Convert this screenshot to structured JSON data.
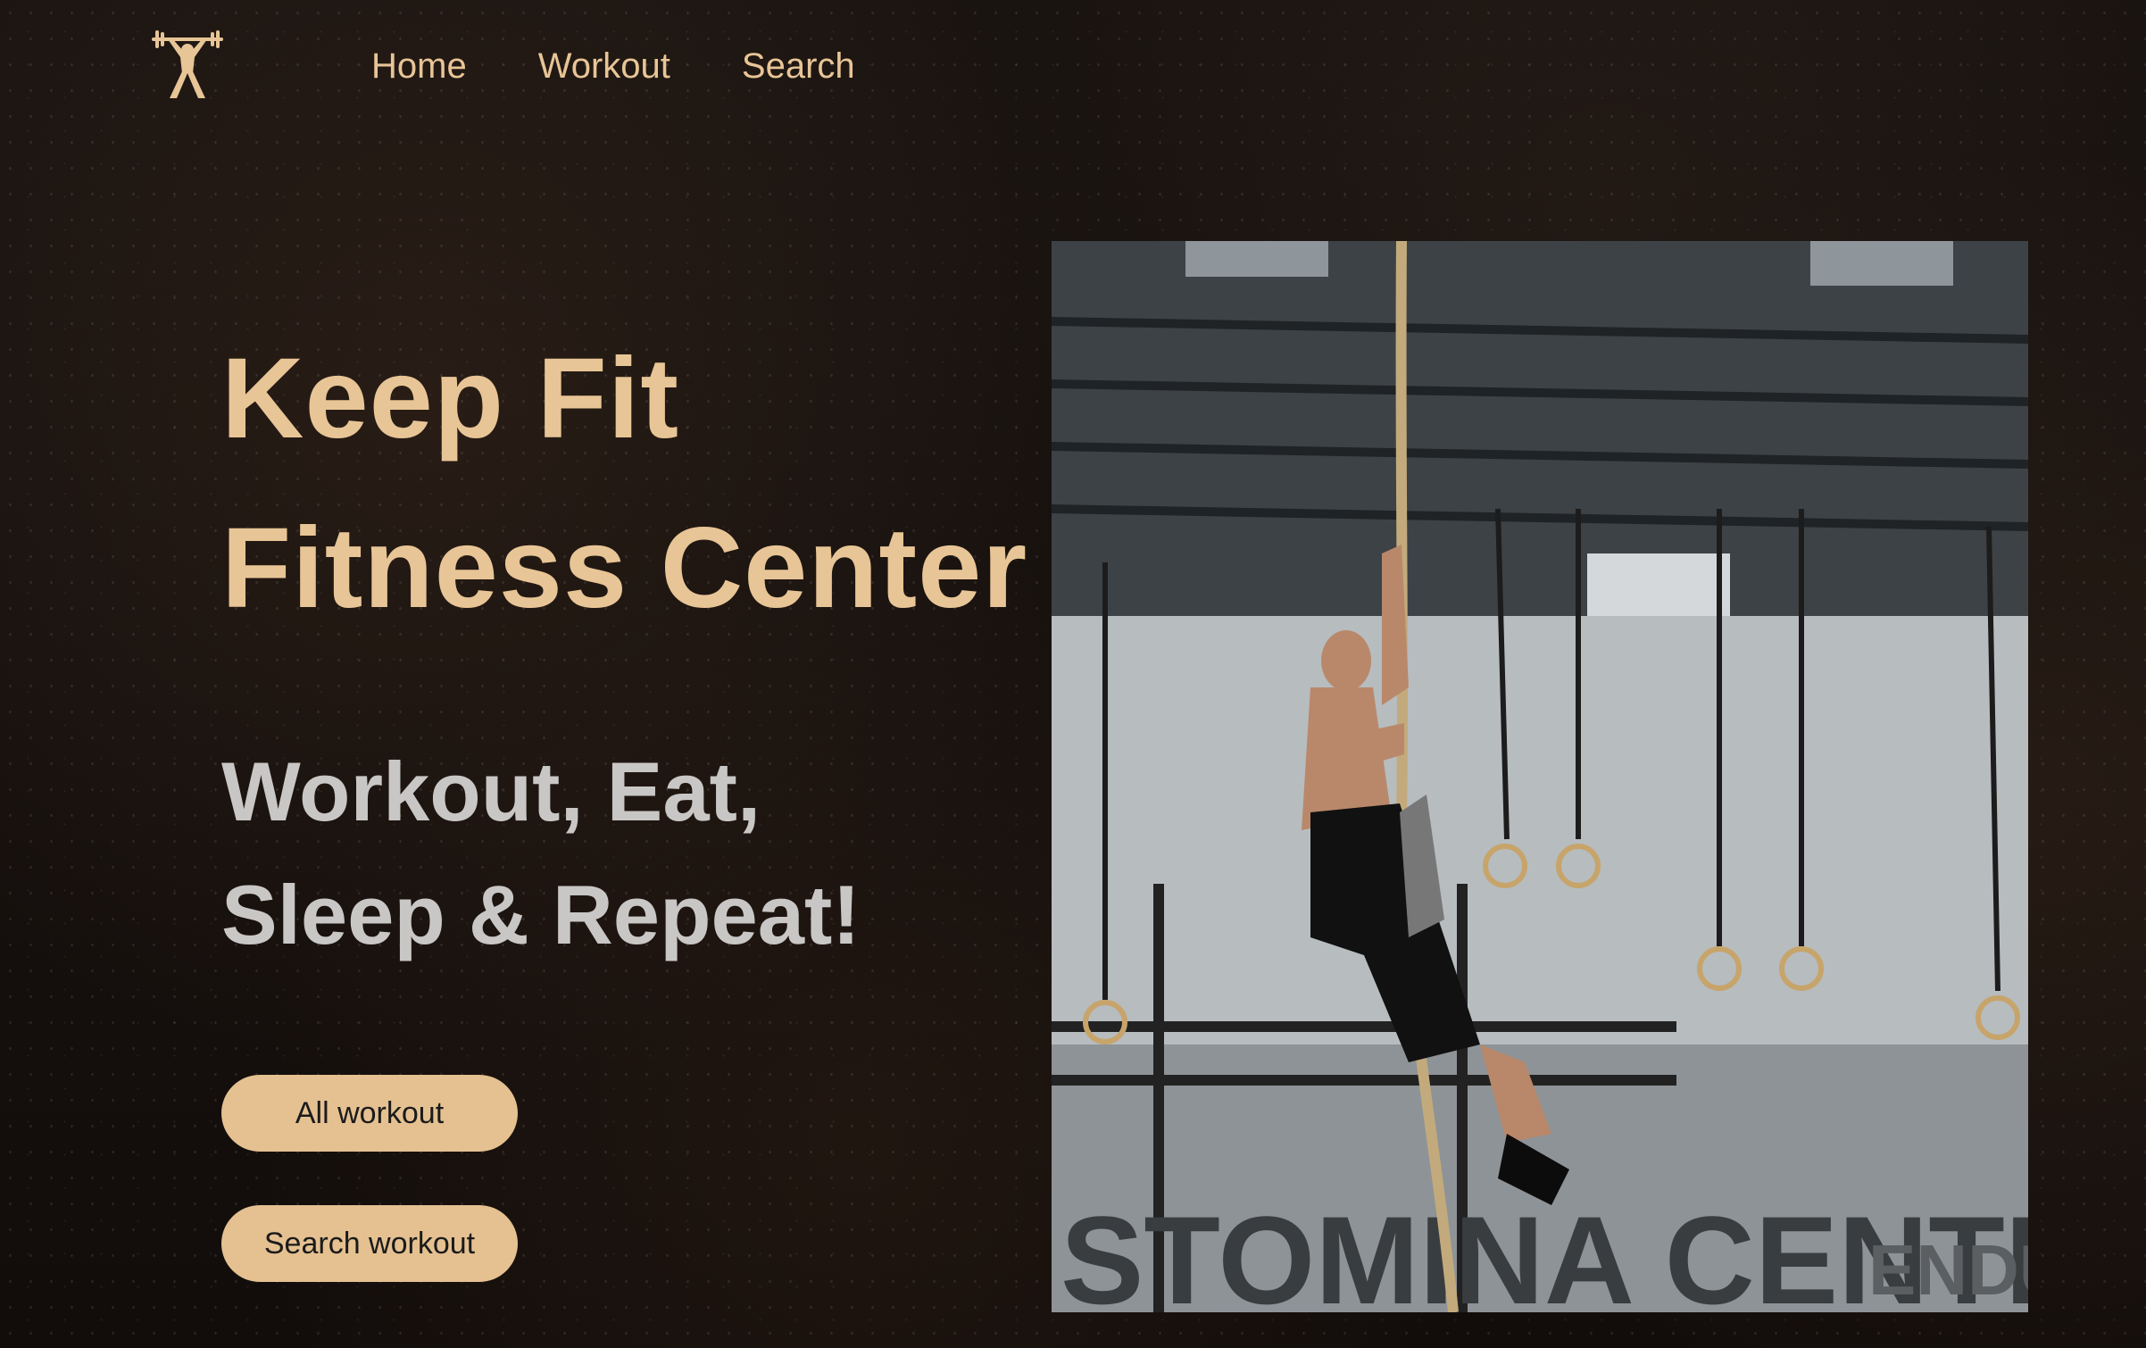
{
  "nav": {
    "items": [
      {
        "label": "Home"
      },
      {
        "label": "Workout"
      },
      {
        "label": "Search"
      }
    ]
  },
  "hero": {
    "title_line1": "Keep Fit",
    "title_line2": "Fitness Center",
    "tagline_line1": "Workout, Eat,",
    "tagline_line2": "Sleep & Repeat!",
    "photo_wall_text_1": "STOMINA CENTER",
    "photo_wall_text_2": "ENDURAN"
  },
  "buttons": {
    "all_workout": "All workout",
    "search_workout": "Search workout"
  },
  "colors": {
    "accent": "#e8c596",
    "button_bg": "#e5c191",
    "tagline": "#c9c7c5",
    "background": "#140f0d"
  },
  "icons": {
    "logo": "weightlifter-icon"
  }
}
